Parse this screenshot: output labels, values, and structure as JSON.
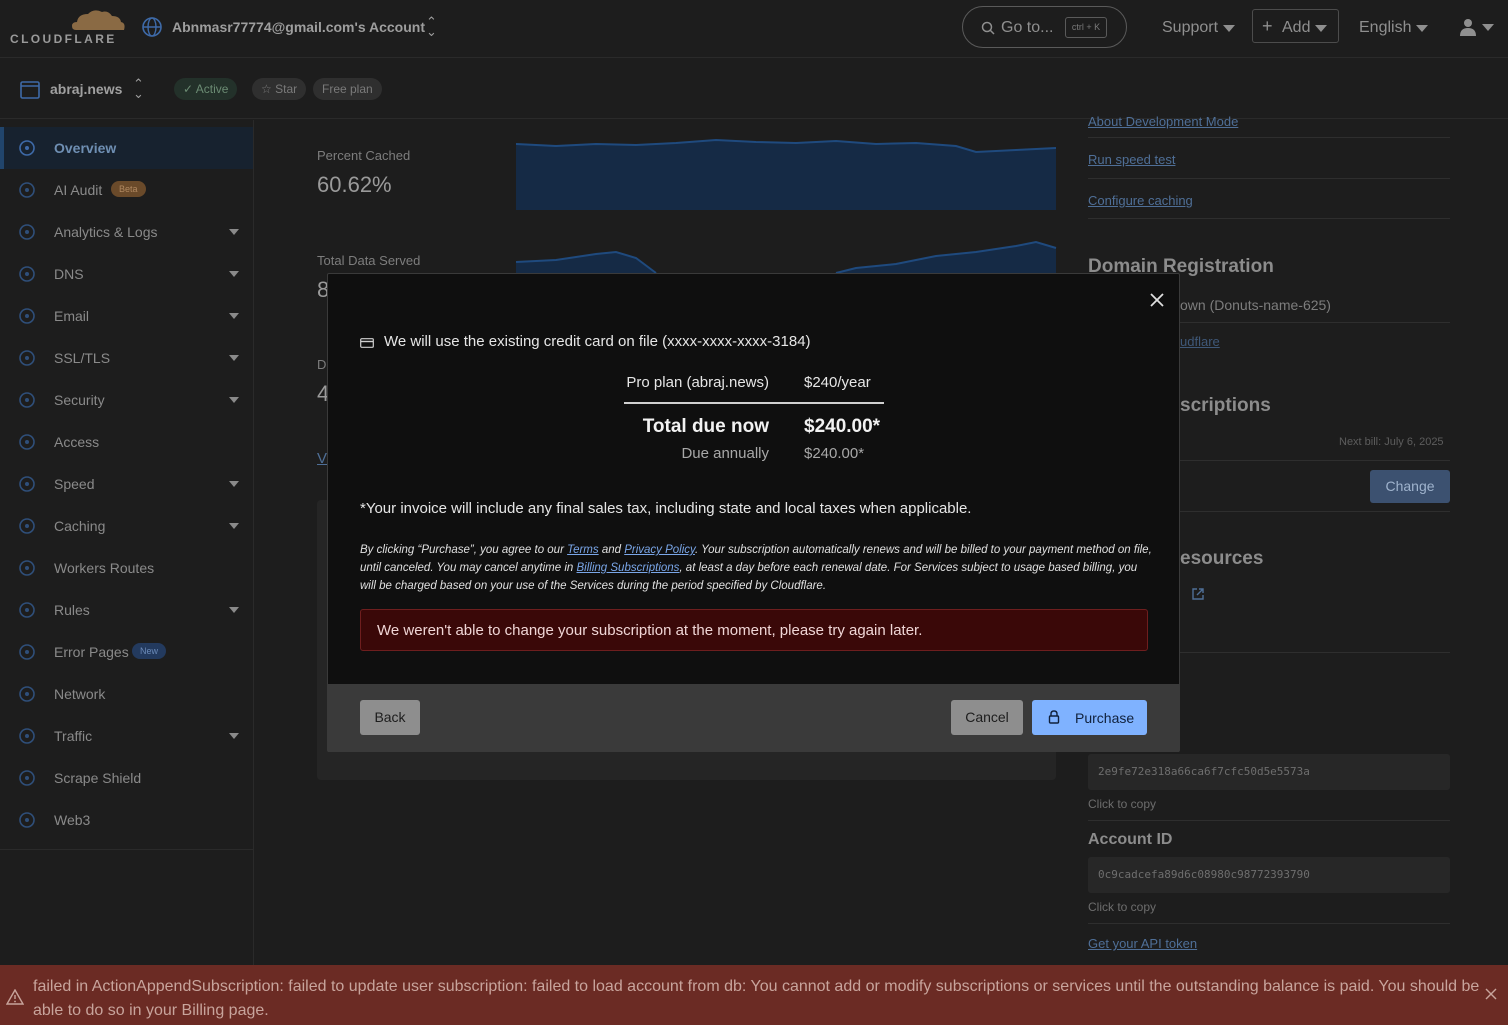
{
  "header": {
    "logo_text": "CLOUDFLARE",
    "account_name": "Abnmasr77774@gmail.com's Account",
    "goto_label": "Go to...",
    "goto_shortcut": "ctrl + K",
    "support_label": "Support",
    "add_label": "Add",
    "language_label": "English",
    "icons": {
      "globe": "globe-icon",
      "search": "search-icon",
      "user": "user-icon"
    }
  },
  "zone": {
    "name": "abraj.news",
    "status": "Active",
    "star_label": "Star",
    "plan": "Free plan"
  },
  "sidebar": {
    "items": [
      {
        "label": "Overview",
        "icon": "overview-icon"
      },
      {
        "label": "AI Audit",
        "icon": "ai-audit-icon",
        "badge": "Beta"
      },
      {
        "label": "Analytics & Logs",
        "icon": "analytics-icon"
      },
      {
        "label": "DNS",
        "icon": "dns-icon"
      },
      {
        "label": "Email",
        "icon": "email-icon"
      },
      {
        "label": "SSL/TLS",
        "icon": "lock-icon"
      },
      {
        "label": "Security",
        "icon": "shield-icon"
      },
      {
        "label": "Access",
        "icon": "access-icon"
      },
      {
        "label": "Speed",
        "icon": "bolt-icon"
      },
      {
        "label": "Caching",
        "icon": "caching-icon"
      },
      {
        "label": "Workers Routes",
        "icon": "workers-icon"
      },
      {
        "label": "Rules",
        "icon": "rules-icon"
      },
      {
        "label": "Error Pages",
        "icon": "wrench-icon",
        "badge": "New"
      },
      {
        "label": "Network",
        "icon": "pin-icon"
      },
      {
        "label": "Traffic",
        "icon": "traffic-icon"
      },
      {
        "label": "Scrape Shield",
        "icon": "scrape-shield-icon"
      },
      {
        "label": "Web3",
        "icon": "web3-icon"
      }
    ]
  },
  "main": {
    "percent_cached_label": "Percent Cached",
    "percent_cached_value": "60.62%",
    "total_data_label": "Total Data Served",
    "total_data_value_partial": "8",
    "third_label_partial": "D",
    "third_value_partial": "4",
    "link_partial": "V"
  },
  "right_panel": {
    "about_dev_mode": "About Development Mode",
    "run_speed_test": "Run speed test",
    "configure_caching": "Configure caching",
    "domain_registration": "Domain Registration",
    "registrar_partial": "own (Donuts-name-625)",
    "cloudflare_link_partial": "udflare",
    "subscriptions_partial": "scriptions",
    "next_bill": "Next bill: July 6, 2025",
    "change_button": "Change",
    "resources_partial": "esources",
    "zone_id_value": "2e9fe72e318a66ca6f7cfc50d5e5573a",
    "click_to_copy": "Click to copy",
    "account_id_label": "Account ID",
    "account_id_value": "0c9cadcefa89d6c08980c98772393790",
    "api_token_link": "Get your API token"
  },
  "modal": {
    "card_note": "We will use the existing credit card on file (xxxx-xxxx-xxxx-3184)",
    "plan_label": "Pro plan (abraj.news)",
    "plan_price": "$240/year",
    "total_label": "Total due now",
    "total_value": "$240.00*",
    "annual_label": "Due annually",
    "annual_value": "$240.00*",
    "tax_note": "*Your invoice will include any final sales tax, including state and local taxes when applicable.",
    "legal_1": "By clicking “Purchase”, you agree to our ",
    "terms_link": "Terms",
    "legal_and": " and ",
    "privacy_link": "Privacy Policy",
    "legal_2": ". Your subscription automatically renews and will be billed to your payment method on file, until canceled. You may cancel anytime in ",
    "billing_link": "Billing Subscriptions",
    "legal_3": ", at least a day before each renewal date. For Services subject to usage based billing, you will be charged based on your use of the Services during the period specified by Cloudflare.",
    "error_message": "We weren't able to change your subscription at the moment, please try again later.",
    "back_button": "Back",
    "cancel_button": "Cancel",
    "purchase_button": "Purchase"
  },
  "banner": {
    "message": "failed in ActionAppendSubscription: failed to update user subscription: failed to load account from db: You cannot add or modify subscriptions or services until the outstanding balance is paid. You should be able to do so in your Billing page.",
    "color": "#6b2b24"
  },
  "colors": {
    "accent": "#7fb2ff",
    "error_bg": "#3a0808",
    "active_nav": "#17222f"
  }
}
